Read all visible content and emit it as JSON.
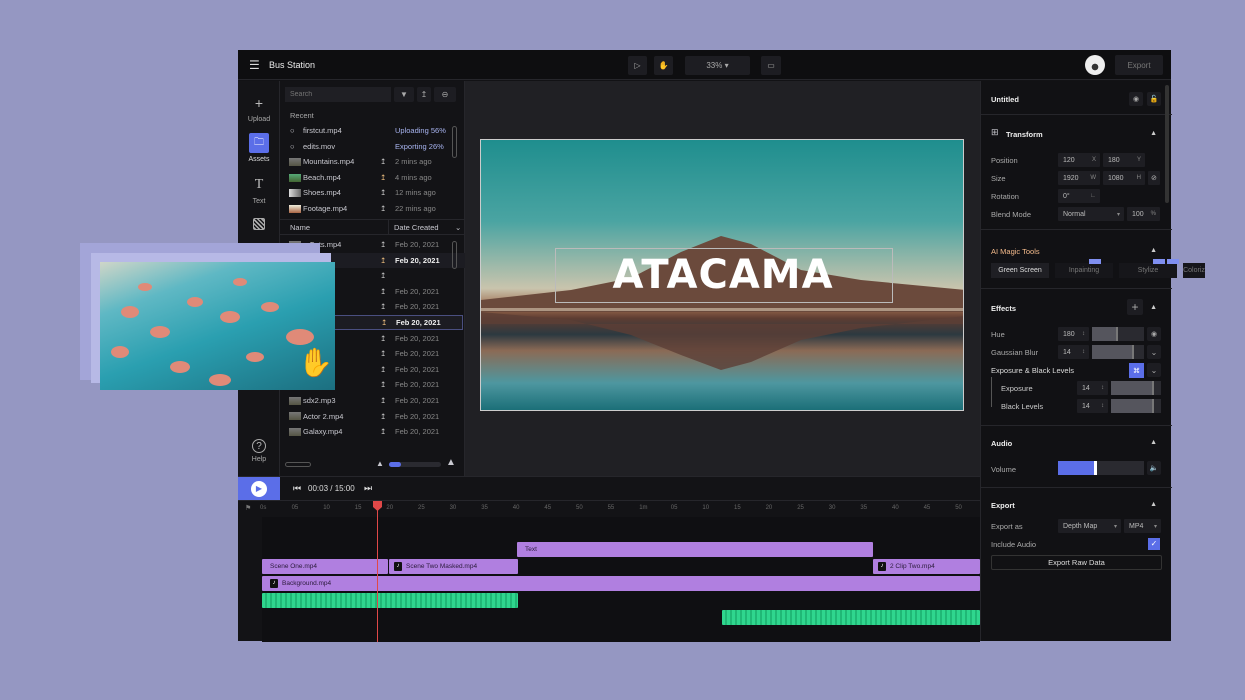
{
  "header": {
    "menu_icon": "hamburger-icon",
    "project_title": "Bus Station",
    "zoom": "33%",
    "export_label": "Export"
  },
  "rail": [
    {
      "label": "Upload",
      "icon": "plus-icon"
    },
    {
      "label": "Assets",
      "icon": "folder-icon"
    },
    {
      "label": "Text",
      "icon": "text-icon"
    },
    {
      "label": "",
      "icon": "pattern-icon"
    },
    {
      "label": "Help",
      "icon": "help-icon"
    }
  ],
  "assets": {
    "search_placeholder": "Search",
    "recent_label": "Recent",
    "recent": [
      {
        "name": "firstcut.mp4",
        "status": "Uploading 56%"
      },
      {
        "name": "edits.mov",
        "status": "Exporting 26%"
      },
      {
        "name": "Mountains.mp4",
        "time": "2 mins ago"
      },
      {
        "name": "Beach.mp4",
        "time": "4 mins ago"
      },
      {
        "name": "Shoes.mp4",
        "time": "12 mins ago"
      },
      {
        "name": "Footage.mp4",
        "time": "22 mins ago"
      }
    ],
    "col_name": "Name",
    "col_date": "Date Created",
    "files": [
      {
        "name": "e Cuts.mp4",
        "date": "Feb 20, 2021"
      },
      {
        "name": "es",
        "date": "Feb 20, 2021",
        "active": true
      },
      {
        "name": "tage.mp4",
        "date": ""
      },
      {
        "name": "",
        "date": "Feb 20, 2021"
      },
      {
        "name": "s",
        "date": "Feb 20, 2021"
      },
      {
        "name": "ots",
        "date": "Feb 20, 2021",
        "active": true
      },
      {
        "name": ".mp4",
        "date": "Feb 20, 2021"
      },
      {
        "name": "ns.mp4",
        "date": "Feb 20, 2021"
      },
      {
        "name": "Shots 2",
        "date": "Feb 20, 2021"
      },
      {
        "name": "x.mp3",
        "date": "Feb 20, 2021"
      },
      {
        "name": "sdx2.mp3",
        "date": "Feb 20, 2021"
      },
      {
        "name": "Actor 2.mp4",
        "date": "Feb 20, 2021"
      },
      {
        "name": "Galaxy.mp4",
        "date": "Feb 20, 2021"
      }
    ]
  },
  "preview": {
    "title_text": "ATACAMA"
  },
  "inspector": {
    "title": "Untitled",
    "transform": {
      "label": "Transform",
      "position_label": "Position",
      "pos_x": "120",
      "pos_y": "180",
      "size_label": "Size",
      "w": "1920",
      "h": "1080",
      "rotation_label": "Rotation",
      "rotation": "0°",
      "blend_label": "Blend Mode",
      "blend": "Normal",
      "opacity": "100",
      "x": "X",
      "y": "Y",
      "wl": "W",
      "hl": "H",
      "pct": "%"
    },
    "ai": {
      "label": "AI Magic Tools",
      "tools": [
        "Green Screen",
        "Inpainting",
        "Stylize",
        "Coloriz"
      ]
    },
    "effects": {
      "label": "Effects",
      "hue_label": "Hue",
      "hue": "180",
      "hue_level": 0.5,
      "blur_label": "Gaussian Blur",
      "blur": "14",
      "blur_level": 0.8,
      "exp_group": "Exposure & Black Levels",
      "exposure_label": "Exposure",
      "exposure": "14",
      "exposure_level": 0.85,
      "black_label": "Black Levels",
      "black": "14",
      "black_level": 0.85
    },
    "audio": {
      "label": "Audio",
      "volume_label": "Volume",
      "volume_level": 0.45
    },
    "export": {
      "label": "Export",
      "export_as_label": "Export as",
      "format": "Depth Map",
      "container": "MP4",
      "include_audio_label": "Include Audio",
      "include_audio": true,
      "raw_button": "Export Raw Data"
    }
  },
  "timeline": {
    "timecode": "00:03 / 15:00",
    "ticks": [
      "0s",
      "05",
      "10",
      "15",
      "20",
      "25",
      "30",
      "35",
      "40",
      "45",
      "50",
      "55",
      "1m",
      "05",
      "10",
      "15",
      "20",
      "25",
      "30",
      "35",
      "40",
      "45",
      "50"
    ],
    "clips": {
      "text": "Text",
      "scene1": "Scene One.mp4",
      "scene2": "Scene Two Masked.mp4",
      "clip2": "2 Clip Two.mp4",
      "bg": "Background.mp4"
    }
  },
  "colors": {
    "accent": "#5b6ee8",
    "clip": "#b07fe0",
    "audio": "#2fd68e",
    "playhead": "#e04848",
    "background": "#9597c2"
  }
}
